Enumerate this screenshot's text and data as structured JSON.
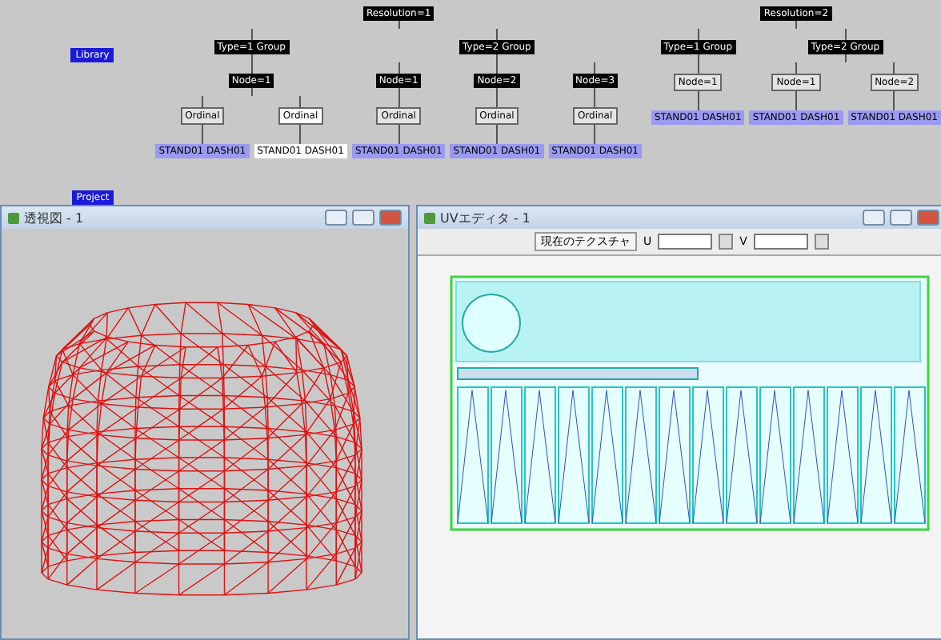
{
  "scene_graph": {
    "side_nodes": [
      {
        "label": "Library",
        "kind": "blue"
      },
      {
        "label": "Project",
        "kind": "blue"
      }
    ],
    "trees": [
      {
        "label": "Resolution=1",
        "kind": "dark",
        "children": [
          {
            "label": "Type=1 Group",
            "kind": "dark",
            "children": [
              {
                "label": "Node=1",
                "kind": "dark",
                "children": [
                  {
                    "label": "Ordinal",
                    "kind": "outline",
                    "selected": false,
                    "children": [
                      {
                        "label": "STAND01 DASH01",
                        "kind": "tag",
                        "selected": false
                      }
                    ]
                  },
                  {
                    "label": "Ordinal",
                    "kind": "outline",
                    "selected": true,
                    "children": [
                      {
                        "label": "STAND01 DASH01",
                        "kind": "tag",
                        "selected": true
                      }
                    ]
                  }
                ]
              }
            ]
          },
          {
            "label": "Type=2 Group",
            "kind": "dark",
            "children": [
              {
                "label": "Node=1",
                "kind": "dark",
                "children": [
                  {
                    "label": "Ordinal",
                    "kind": "outline",
                    "selected": false,
                    "children": [
                      {
                        "label": "STAND01 DASH01",
                        "kind": "tag",
                        "selected": false
                      }
                    ]
                  }
                ]
              },
              {
                "label": "Node=2",
                "kind": "dark",
                "children": [
                  {
                    "label": "Ordinal",
                    "kind": "outline",
                    "selected": false,
                    "children": [
                      {
                        "label": "STAND01 DASH01",
                        "kind": "tag",
                        "selected": false
                      }
                    ]
                  }
                ]
              },
              {
                "label": "Node=3",
                "kind": "dark",
                "children": [
                  {
                    "label": "Ordinal",
                    "kind": "outline",
                    "selected": false,
                    "children": [
                      {
                        "label": "STAND01 DASH01",
                        "kind": "tag",
                        "selected": false
                      }
                    ]
                  }
                ]
              }
            ]
          }
        ]
      },
      {
        "label": "Resolution=2",
        "kind": "dark",
        "children": [
          {
            "label": "Type=1 Group",
            "kind": "dark",
            "children": [
              {
                "label": "Node=1",
                "kind": "outline",
                "selected": false,
                "children": [
                  {
                    "label": "STAND01 DASH01",
                    "kind": "tag",
                    "selected": false
                  }
                ]
              }
            ]
          },
          {
            "label": "Type=2 Group",
            "kind": "dark",
            "children": [
              {
                "label": "Node=1",
                "kind": "outline",
                "selected": false,
                "children": [
                  {
                    "label": "STAND01 DASH01",
                    "kind": "tag",
                    "selected": false
                  }
                ]
              },
              {
                "label": "Node=2",
                "kind": "outline",
                "selected": false,
                "children": [
                  {
                    "label": "STAND01 DASH01",
                    "kind": "tag",
                    "selected": false
                  }
                ]
              }
            ]
          }
        ]
      }
    ]
  },
  "windows": [
    {
      "title": "透視図 - 1",
      "kind": "viewport"
    },
    {
      "title": "UVエディタ - 1",
      "kind": "uv",
      "toolbar": {
        "label": "現在のテクスチャ",
        "fields": [
          {
            "label": "U"
          },
          {
            "label": "V"
          }
        ]
      }
    }
  ]
}
